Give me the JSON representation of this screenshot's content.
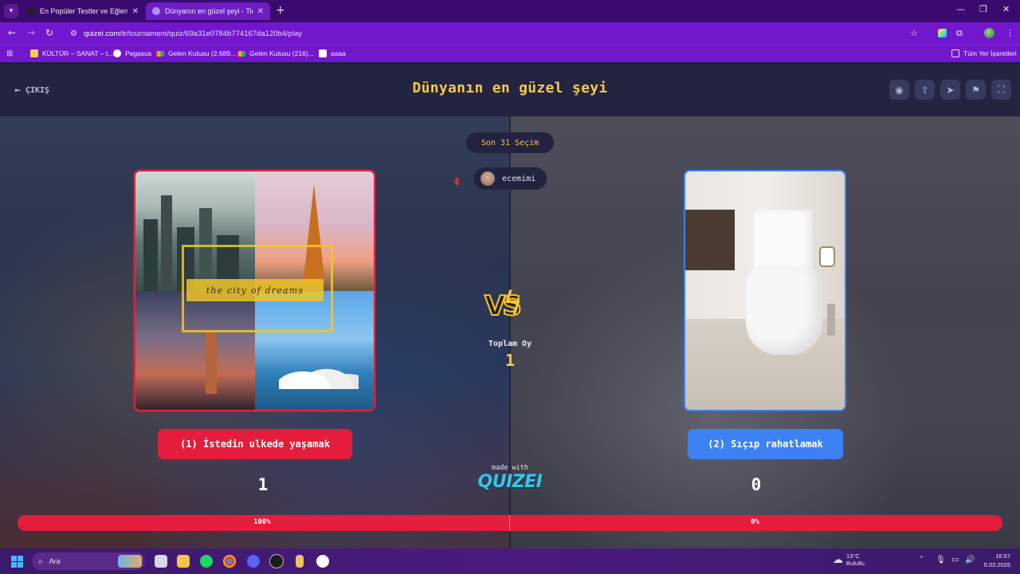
{
  "browser": {
    "tabs": [
      {
        "title": "En Popüler Testler ve Eğlenceli Quizler",
        "active": false
      },
      {
        "title": "Dünyanın en güzel şeyi - Tier List",
        "active": true
      }
    ],
    "url_host": "quizei.com",
    "url_path": "/tr/tournament/quiz/69a31e0784b774167da120b4/play",
    "bookmarks": [
      {
        "label": "KÜLTÜR – SANAT – t...",
        "icon": "folder-icon"
      },
      {
        "label": "Pegasus",
        "icon": "pegasus-icon"
      },
      {
        "label": "Gelen Kutusu (2.689...",
        "icon": "gmail-icon"
      },
      {
        "label": "Gelen Kutusu (216)...",
        "icon": "gmail-icon"
      },
      {
        "label": "aaaa",
        "icon": "app-icon"
      }
    ],
    "all_bookmarks": "Tüm Yer İşaretleri"
  },
  "page": {
    "exit_label": "ÇIKIŞ",
    "title": "Dünyanın en güzel şeyi",
    "header_buttons": [
      "eye-icon",
      "share-icon",
      "send-icon",
      "flag-icon",
      "fullscreen-icon"
    ],
    "round_label": "Son 31 Seçim",
    "user": {
      "name": "ecemimi"
    },
    "total_label": "Toplam Oy",
    "total_votes": 1,
    "left": {
      "image_caption": "the city of dreams",
      "choice_label": "(1) İstedin ulkede yaşamak",
      "votes": 1,
      "percent_label": "100%",
      "percent": 100
    },
    "right": {
      "choice_label": "(2) Sıçıp rahatlamak",
      "votes": 0,
      "percent_label": "0%",
      "percent": 0
    },
    "made_with": "made with",
    "logo": "QUIZEI"
  },
  "colors": {
    "left_accent": "#e51d3d",
    "right_accent": "#3d82f5",
    "title_gold": "#f5c84b",
    "browser_purple": "#7117cc"
  },
  "taskbar": {
    "search_placeholder": "Ara",
    "weather_temp": "13°C",
    "weather_desc": "Bulutlu",
    "time": "16:57",
    "date": "5.03.2026"
  }
}
